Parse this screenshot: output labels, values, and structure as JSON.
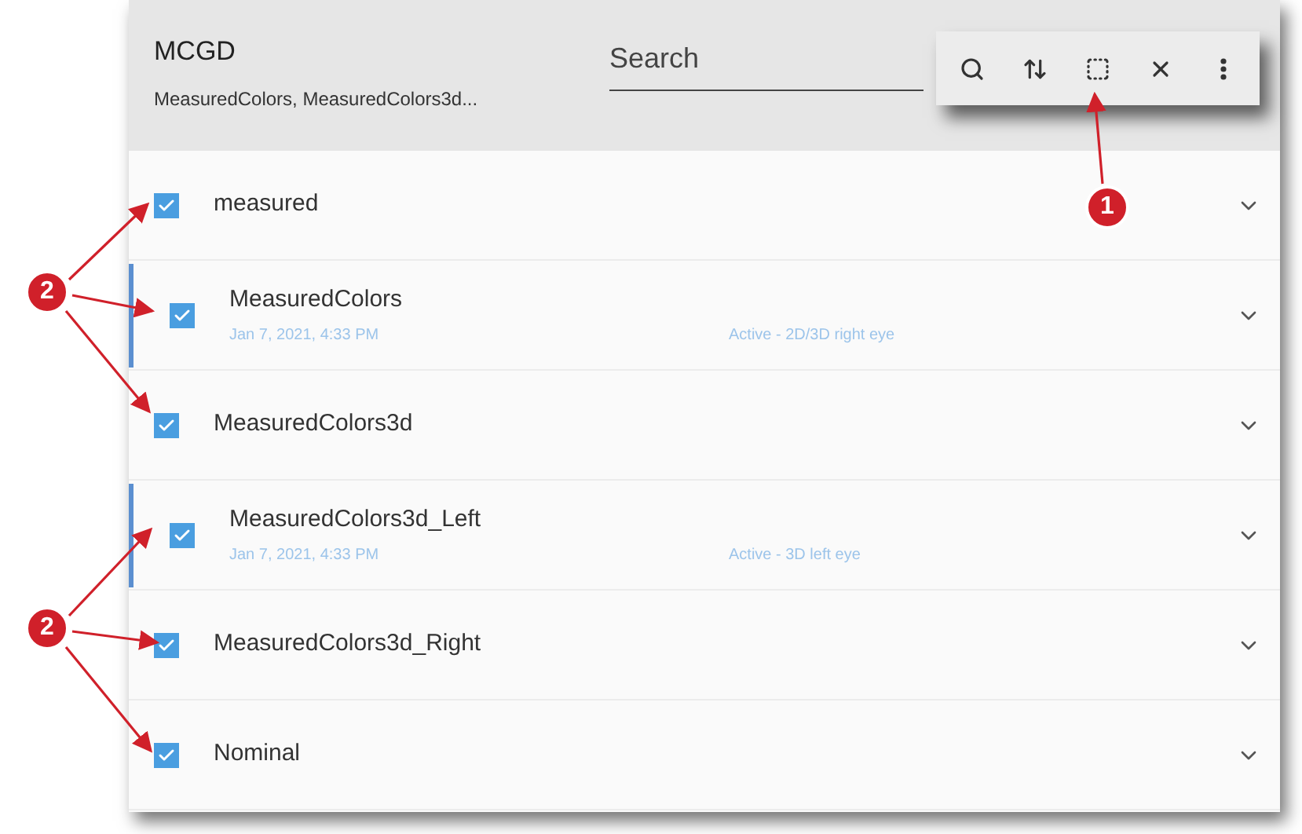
{
  "header": {
    "title": "MCGD",
    "subtitle": "MeasuredColors, MeasuredColors3d...",
    "search": {
      "placeholder": "Search"
    }
  },
  "toolbar": {
    "buttons": [
      {
        "kind": "search"
      },
      {
        "kind": "sort"
      },
      {
        "kind": "select"
      },
      {
        "kind": "close"
      },
      {
        "kind": "more"
      }
    ]
  },
  "rows": [
    {
      "name": "measured",
      "checked": true,
      "active": false
    },
    {
      "name": "MeasuredColors",
      "checked": true,
      "active": true,
      "date": "Jan 7, 2021, 4:33 PM",
      "status": "Active - 2D/3D right eye"
    },
    {
      "name": "MeasuredColors3d",
      "checked": true,
      "active": false
    },
    {
      "name": "MeasuredColors3d_Left",
      "checked": true,
      "active": true,
      "date": "Jan 7, 2021, 4:33 PM",
      "status": "Active - 3D left eye"
    },
    {
      "name": "MeasuredColors3d_Right",
      "checked": true,
      "active": false
    },
    {
      "name": "Nominal",
      "checked": true,
      "active": false
    }
  ],
  "callouts": [
    {
      "label": "1"
    },
    {
      "label": "2"
    },
    {
      "label": "2"
    }
  ]
}
